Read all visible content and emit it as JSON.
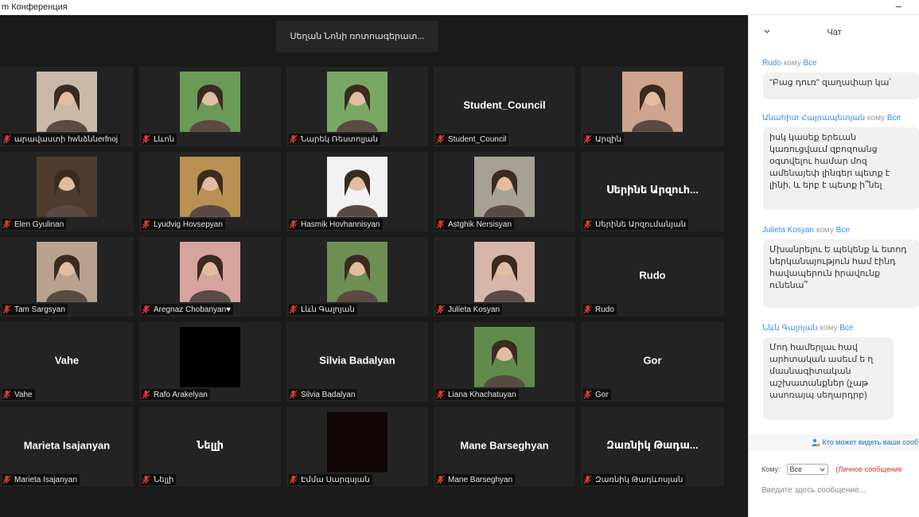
{
  "window": {
    "title": "m Конференция",
    "minimize_icon": "minimize-icon"
  },
  "video": {
    "recording_banner": "Սեղան Նոնի ռոտոագերատ...",
    "tiles": [
      {
        "name": "արավաստի hwնձննerfnoj",
        "photo": true,
        "photo_tone": "#c9b9a6"
      },
      {
        "name": "Լևոն",
        "photo": true,
        "photo_tone": "#6a9a58"
      },
      {
        "name": "Նարեկ Ռեստոլյան",
        "photo": true,
        "photo_tone": "#79a865"
      },
      {
        "name": "Student_Council",
        "big_name": "Student_Council",
        "photo": false
      },
      {
        "name": "Արզին",
        "photo": true,
        "photo_tone": "#cfa48f"
      },
      {
        "name": "Elen Gyulinan",
        "photo": true,
        "photo_tone": "#4e3c2e"
      },
      {
        "name": "Lyudvig Hovsepyan",
        "photo": true,
        "photo_tone": "#b99152"
      },
      {
        "name": "Hasmik Hovhannisyan",
        "photo": true,
        "photo_tone": "#f2f2f2"
      },
      {
        "name": "Astghik Nersisyan",
        "photo": true,
        "photo_tone": "#a6a293"
      },
      {
        "name": "Սերինե Արզումանյան",
        "big_name": "Սերինե Արզուհ...",
        "photo": false
      },
      {
        "name": "Tam Sargsyan",
        "photo": true,
        "photo_tone": "#b9a38f"
      },
      {
        "name": "Aregnaz Chobanyan♥",
        "photo": true,
        "photo_tone": "#d6a49e"
      },
      {
        "name": "Լևն Գալոյան",
        "photo": true,
        "photo_tone": "#6e8f53"
      },
      {
        "name": "Julieta Kosyan",
        "photo": true,
        "photo_tone": "#d6b6a8"
      },
      {
        "name": "Rudo",
        "big_name": "Rudo",
        "photo": false
      },
      {
        "name": "Vahe",
        "big_name": "Vahe",
        "photo": false
      },
      {
        "name": "Rafo Arakelyan",
        "photo": true,
        "photo_tone": "#000000",
        "blank": true
      },
      {
        "name": "Silvia Badalyan",
        "big_name": "Silvia Badalyan",
        "photo": false
      },
      {
        "name": "Liana Khachatuyan",
        "photo": true,
        "photo_tone": "#5f8c4a"
      },
      {
        "name": "Gor",
        "big_name": "Gor",
        "photo": false
      },
      {
        "name": "Marieta Isajanyan",
        "big_name": "Marieta Isajanyan",
        "photo": false
      },
      {
        "name": "Նելլի",
        "big_name": "Նելլի",
        "photo": false
      },
      {
        "name": "Էմմա Սարգսյան",
        "photo": true,
        "photo_tone": "#120707",
        "blank": true
      },
      {
        "name": "Mane Barseghyan",
        "big_name": "Mane Barseghyan",
        "photo": false
      },
      {
        "name": "Զառնիկ Թադևոսյան",
        "big_name": "Զառնիկ Թադա...",
        "photo": false
      }
    ],
    "colors": {
      "tile_bg": "#232323",
      "video_bg": "#1a1a1a",
      "muted_icon": "#e03a3a"
    }
  },
  "chat": {
    "title": "Чат",
    "collapse_icon": "chevron-down-icon",
    "messages": [
      {
        "sender": "Rudo",
        "to": "кому",
        "recipient": "Все",
        "text": "\"Բաց դուռ\" զաղափար կա՝"
      },
      {
        "sender": "Անահիտ Հայրապետյան",
        "to": "кому",
        "recipient": "Все",
        "text": "իսկ կասեք երեւան կառուցվաւմ զբոզոանց օգտվելու համար մոզ ամենայեփ լինգեր պետք է լինի, և երբ է պետք ի՞նել"
      },
      {
        "sender": "Julieta Kosyan",
        "to": "кому",
        "recipient": "Все",
        "text": "Մխանրելու Ե պեկենք և ետոդ ներկանայություն համ էինդ հավապերուն իրավունք ունենա՞"
      },
      {
        "sender": "Նևն Գալոյան",
        "to": "кому",
        "recipient": "Все",
        "text": "Մոդ համերլաւ հավ արհտական ասեւմ ե ղ մասնագիտական աշխատանքներ (չաթ ասոռայպ սեղարդրբ)"
      }
    ],
    "info_line": "Кто может видеть ваши сооб",
    "to_label": "Кому:",
    "to_value": "Все",
    "private_label": "(Личное сообщение",
    "input_placeholder": "Введите здесь сообщение...",
    "colors": {
      "link": "#2d8cff",
      "private": "#d93030"
    }
  }
}
